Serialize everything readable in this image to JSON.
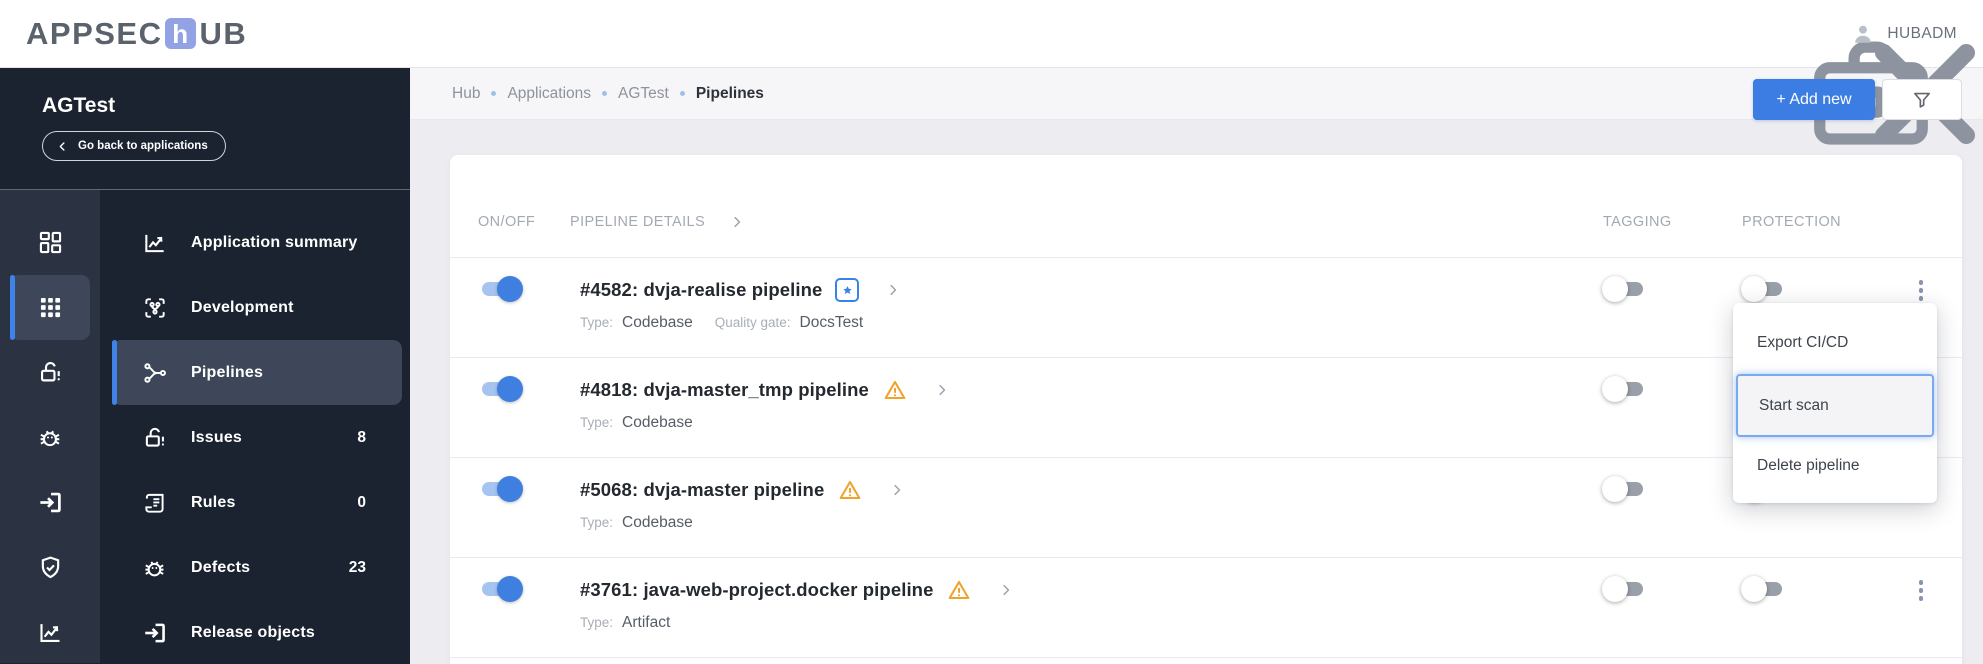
{
  "topbar": {
    "logo": {
      "prefix": "APPSEC",
      "accent": "h",
      "suffix": "UB"
    },
    "username": "HUBADM"
  },
  "sidebar": {
    "app_name": "AGTest",
    "back_label": "Go back to applications",
    "menu": [
      {
        "label": "Application summary"
      },
      {
        "label": "Development"
      },
      {
        "label": "Pipelines",
        "active": true
      },
      {
        "label": "Issues",
        "count": "8"
      },
      {
        "label": "Rules",
        "count": "0"
      },
      {
        "label": "Defects",
        "count": "23"
      },
      {
        "label": "Release objects"
      }
    ]
  },
  "breadcrumb": {
    "items": [
      "Hub",
      "Applications",
      "AGTest",
      "Pipelines"
    ]
  },
  "toolbar": {
    "add_new_label": "+ Add new"
  },
  "table": {
    "columns": {
      "on_off": "ON/OFF",
      "details": "PIPELINE DETAILS",
      "tagging": "TAGGING",
      "protection": "PROTECTION"
    },
    "rows": [
      {
        "title": "#4582: dvja-realise pipeline",
        "enabled": true,
        "badge": "favorite",
        "type_label": "Type:",
        "type_value": "Codebase",
        "quality_gate_label": "Quality gate:",
        "quality_gate_value": "DocsTest",
        "tagging_enabled": false,
        "protection_enabled": false
      },
      {
        "title": "#4818: dvja-master_tmp pipeline",
        "enabled": true,
        "badge": "warning",
        "type_label": "Type:",
        "type_value": "Codebase",
        "tagging_enabled": false
      },
      {
        "title": "#5068: dvja-master pipeline",
        "enabled": true,
        "badge": "warning",
        "type_label": "Type:",
        "type_value": "Codebase",
        "tagging_enabled": false
      },
      {
        "title": "#3761: java-web-project.docker pipeline",
        "enabled": true,
        "badge": "warning",
        "type_label": "Type:",
        "type_value": "Artifact",
        "tagging_enabled": false,
        "protection_enabled": false
      }
    ]
  },
  "context_menu": {
    "items": [
      {
        "label": "Export CI/CD"
      },
      {
        "label": "Start scan",
        "focused": true
      },
      {
        "label": "Delete pipeline"
      }
    ]
  },
  "colors": {
    "accent_blue": "#3b7de2",
    "warning_orange": "#efa32b",
    "toggle_on_blue": "#3f7fe0",
    "sidebar_dark": "#1b2230"
  }
}
